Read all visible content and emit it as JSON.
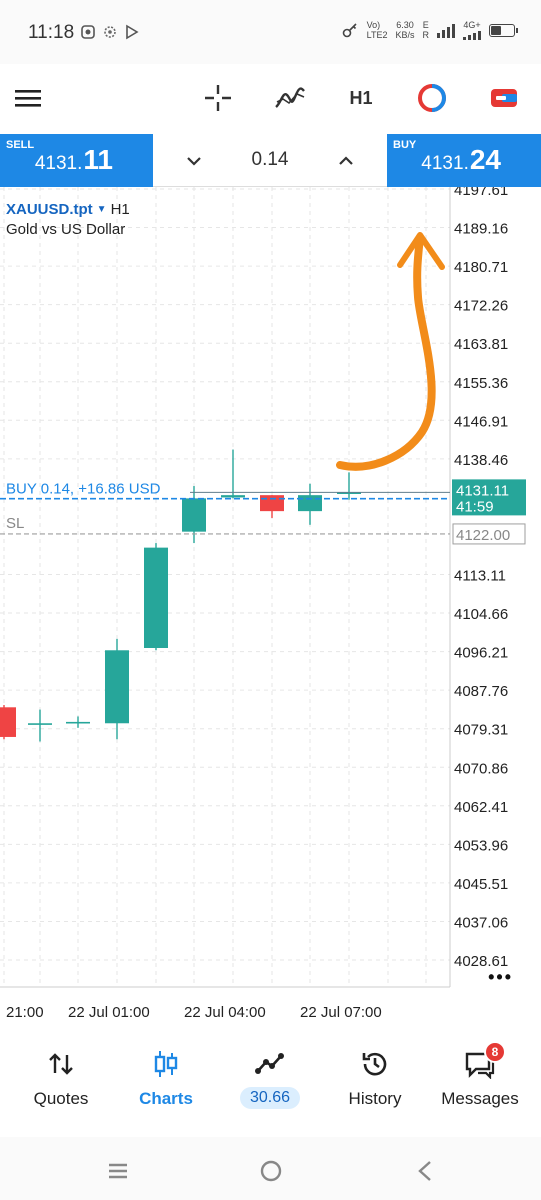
{
  "status_bar": {
    "time": "11:18",
    "network_speed": "6.30",
    "network_unit": "KB/s",
    "volte": "Vo)",
    "lte": "LTE2",
    "mode_e": "E",
    "mode_r": "R",
    "net_4g": "4G+"
  },
  "toolbar": {
    "timeframe": "H1"
  },
  "trade": {
    "sell_label": "SELL",
    "sell_price_main": "4131.",
    "sell_price_big": "11",
    "volume": "0.14",
    "buy_label": "BUY",
    "buy_price_main": "4131.",
    "buy_price_big": "24"
  },
  "chart": {
    "symbol": "XAUUSD.tpt",
    "timeframe": "H1",
    "description": "Gold vs US Dollar",
    "position_label": "BUY 0.14,  +16.86 USD",
    "sl_label": "SL",
    "current_price": "4131.11",
    "countdown": "41:59",
    "sl_price": "4122.00",
    "more": "•••"
  },
  "chart_data": {
    "type": "candlestick",
    "timeframe": "H1",
    "price_axis": [
      "4197.61",
      "4189.16",
      "4180.71",
      "4172.26",
      "4163.81",
      "4155.36",
      "4146.91",
      "4138.46",
      "4113.11",
      "4104.66",
      "4096.21",
      "4087.76",
      "4079.31",
      "4070.86",
      "4062.41",
      "4053.96",
      "4045.51",
      "4037.06",
      "4028.61"
    ],
    "ylim": [
      4024,
      4199
    ],
    "time_axis": [
      "21:00",
      "22 Jul 01:00",
      "22 Jul 04:00",
      "22 Jul 07:00"
    ],
    "candles": [
      {
        "open": 4084.0,
        "close": 4077.5,
        "high": 4084.5,
        "low": 4077.0
      },
      {
        "open": 4080.5,
        "close": 4080.5,
        "high": 4083.5,
        "low": 4076.5
      },
      {
        "open": 4080.5,
        "close": 4080.8,
        "high": 4082.0,
        "low": 4079.5
      },
      {
        "open": 4080.5,
        "close": 4096.5,
        "high": 4099.0,
        "low": 4077.0
      },
      {
        "open": 4097.0,
        "close": 4119.0,
        "high": 4120.0,
        "low": 4096.5
      },
      {
        "open": 4122.5,
        "close": 4129.8,
        "high": 4132.5,
        "low": 4120.0
      },
      {
        "open": 4130.0,
        "close": 4130.5,
        "high": 4140.5,
        "low": 4129.8
      },
      {
        "open": 4130.5,
        "close": 4127.0,
        "high": 4130.5,
        "low": 4125.5
      },
      {
        "open": 4127.0,
        "close": 4130.5,
        "high": 4133.0,
        "low": 4124.0
      },
      {
        "open": 4130.8,
        "close": 4131.11,
        "high": 4135.5,
        "low": 4129.5
      }
    ],
    "position_price": 4130.6,
    "sl_price": 4122.0,
    "current_price": 4131.11,
    "bull_color": "#26a69a",
    "bear_color": "#ef4444",
    "annotation_color": "#f28c1a"
  },
  "nav": {
    "quotes": "Quotes",
    "charts": "Charts",
    "trade": "30.66",
    "history": "History",
    "messages": "Messages",
    "messages_badge": "8"
  },
  "colors": {
    "accent": "#1e88e5",
    "bull": "#26a69a",
    "bear": "#ef4444"
  }
}
